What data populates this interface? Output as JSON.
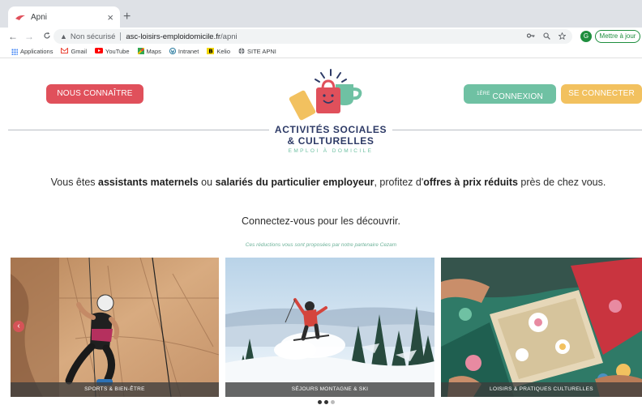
{
  "browser": {
    "tab_title": "Apni",
    "tab_close": "×",
    "new_tab": "+",
    "nav": {
      "back": "←",
      "forward": "→",
      "reload": "C"
    },
    "omnibox": {
      "warning_icon": "▲",
      "security_label": "Non sécurisé",
      "host": "asc-loisirs-emploidomicile.fr",
      "path": "/apni"
    },
    "profile_initial": "G",
    "update_button": "Mettre à jour",
    "bookmarks": [
      {
        "label": "Applications",
        "icon": "apps-grid-icon",
        "color": "#4285f4"
      },
      {
        "label": "Gmail",
        "icon": "gmail-icon",
        "color": "#ea4335"
      },
      {
        "label": "YouTube",
        "icon": "youtube-icon",
        "color": "#ff0000"
      },
      {
        "label": "Maps",
        "icon": "maps-icon",
        "color": "#34a853"
      },
      {
        "label": "Intranet",
        "icon": "wordpress-icon",
        "color": "#21759b"
      },
      {
        "label": "Kelio",
        "icon": "kelio-icon",
        "color": "#f2d600"
      },
      {
        "label": "SITE APNI",
        "icon": "globe-icon",
        "color": "#5f6368"
      }
    ]
  },
  "header": {
    "nous_button": "NOUS CONNAÎTRE",
    "premiere_sup": "1ÈRE",
    "premiere_label": " CONNEXION",
    "connecter_button": "SE CONNECTER"
  },
  "logo": {
    "line1": "ACTIVITÉS SOCIALES",
    "line2": "& CULTURELLES",
    "line3": "EMPLOI À DOMICILE"
  },
  "intro": {
    "p1": "Vous êtes ",
    "b1": "assistants maternels",
    "p2": " ou ",
    "b2": "salariés du particulier employeur",
    "p3": ", profitez d'",
    "b3": "offres à prix réduits",
    "p4": " près de chez vous."
  },
  "connect_text": "Connectez-vous pour les découvrir.",
  "partner_text": "Ces réductions vous sont proposées par notre partenaire Cezam",
  "cards": [
    {
      "label": "SPORTS & BIEN-ÊTRE"
    },
    {
      "label": "SÉJOURS MONTAGNE & SKI"
    },
    {
      "label": "LOISIRS & PRATIQUES CULTURELLES"
    }
  ],
  "colors": {
    "red": "#e0505b",
    "green": "#6fc1a3",
    "yellow": "#f2c15f",
    "navy": "#2d3a66"
  }
}
